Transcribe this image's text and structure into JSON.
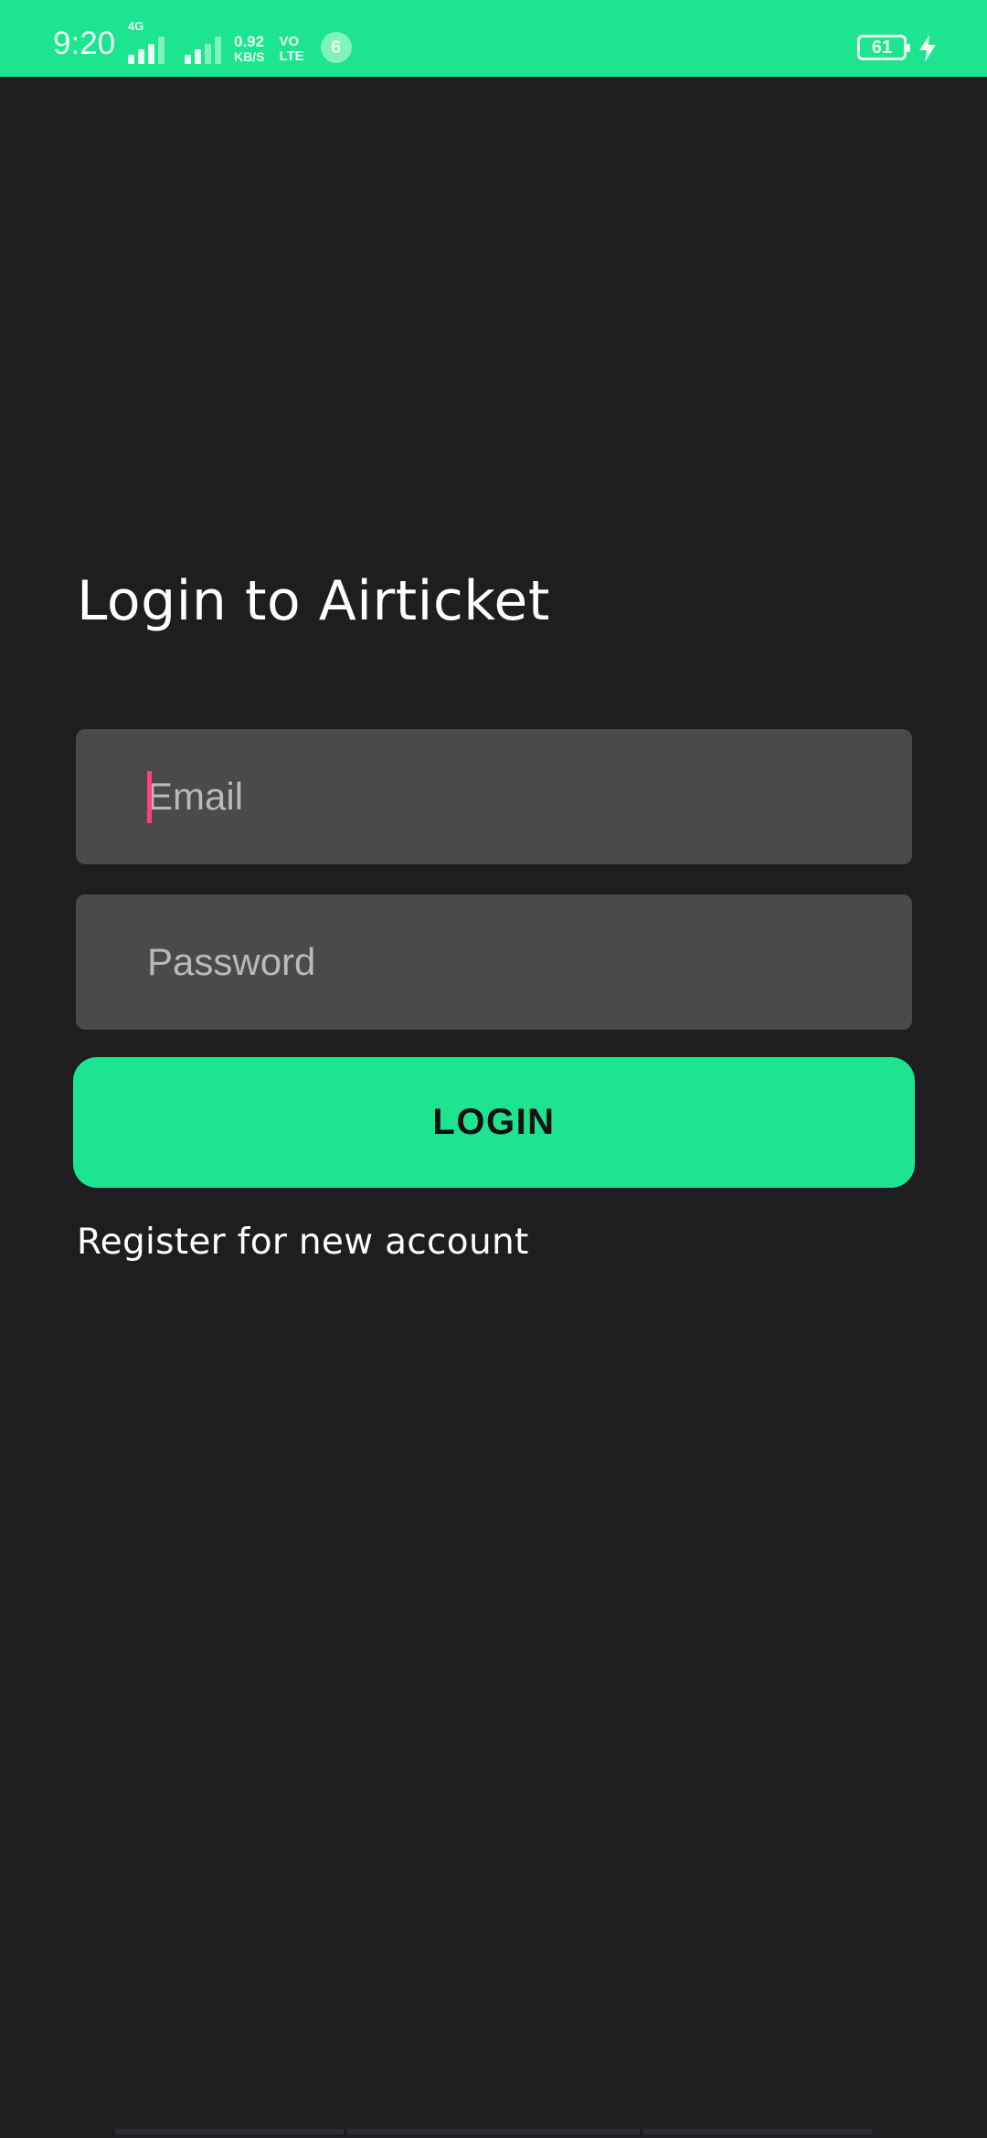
{
  "status_bar": {
    "time": "9:20",
    "network_type": "4G",
    "data_speed_value": "0.92",
    "data_speed_unit": "KB/S",
    "volte_line1": "VO",
    "volte_line2": "LTE",
    "notification_count": "6",
    "battery_level": "61",
    "charging": true,
    "icons": [
      "signal-sim1-icon",
      "signal-sim2-icon",
      "volte-icon",
      "battery-icon",
      "charging-icon"
    ]
  },
  "login": {
    "title": "Login to Airticket",
    "email_placeholder": "Email",
    "email_value": "",
    "password_placeholder": "Password",
    "password_value": "",
    "login_button_label": "LOGIN",
    "register_link_label": "Register for new account"
  },
  "colors": {
    "accent": "#1de48f",
    "background": "#1e1d20",
    "input_background": "#4a494c",
    "caret": "#ff3f7e"
  }
}
